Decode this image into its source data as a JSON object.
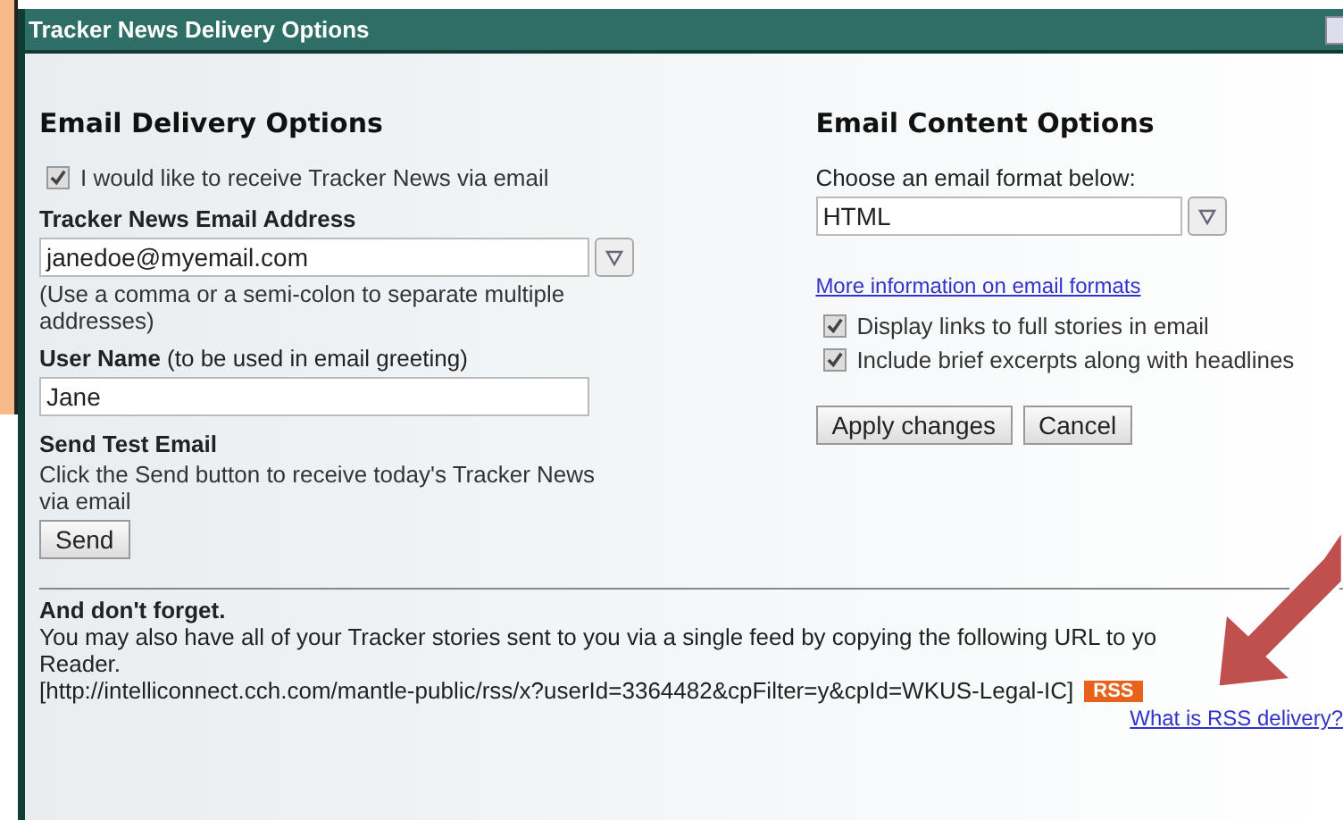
{
  "window": {
    "title": "Tracker News Delivery Options"
  },
  "delivery": {
    "heading": "Email Delivery Options",
    "receive": {
      "label": "I would like to receive Tracker News via email",
      "checked": true
    },
    "email_label": "Tracker News Email Address",
    "email_value": "janedoe@myemail.com",
    "email_hint": "(Use a comma or a semi-colon to separate multiple addresses)",
    "username_label": "**User Name** (to be used in email greeting)",
    "username_value": "Jane",
    "test_heading": "Send Test Email",
    "test_text": "Click the Send button to receive today's Tracker News via email",
    "send_button": "Send"
  },
  "content": {
    "heading": "Email Content Options",
    "format_label": "Choose an email format below:",
    "format_value": "HTML",
    "format_link": "More information on email formats",
    "options": [
      {
        "label": "Display links to full stories in email",
        "checked": true
      },
      {
        "label": "Include brief excerpts along with headlines",
        "checked": true
      }
    ],
    "buttons": [
      "Apply changes",
      "Cancel"
    ]
  },
  "footer": {
    "heading": "And don't forget.",
    "lines": [
      "You may also have all of your Tracker stories sent to you via a single feed by copying the following URL to yo",
      "Reader."
    ],
    "url": "[http://intelliconnect.cch.com/mantle-public/rss/x?userId=3364482&cpFilter=y&cpId=WKUS-Legal-IC]",
    "rss_badge": "RSS",
    "rss_link": "What is RSS delivery?"
  }
}
